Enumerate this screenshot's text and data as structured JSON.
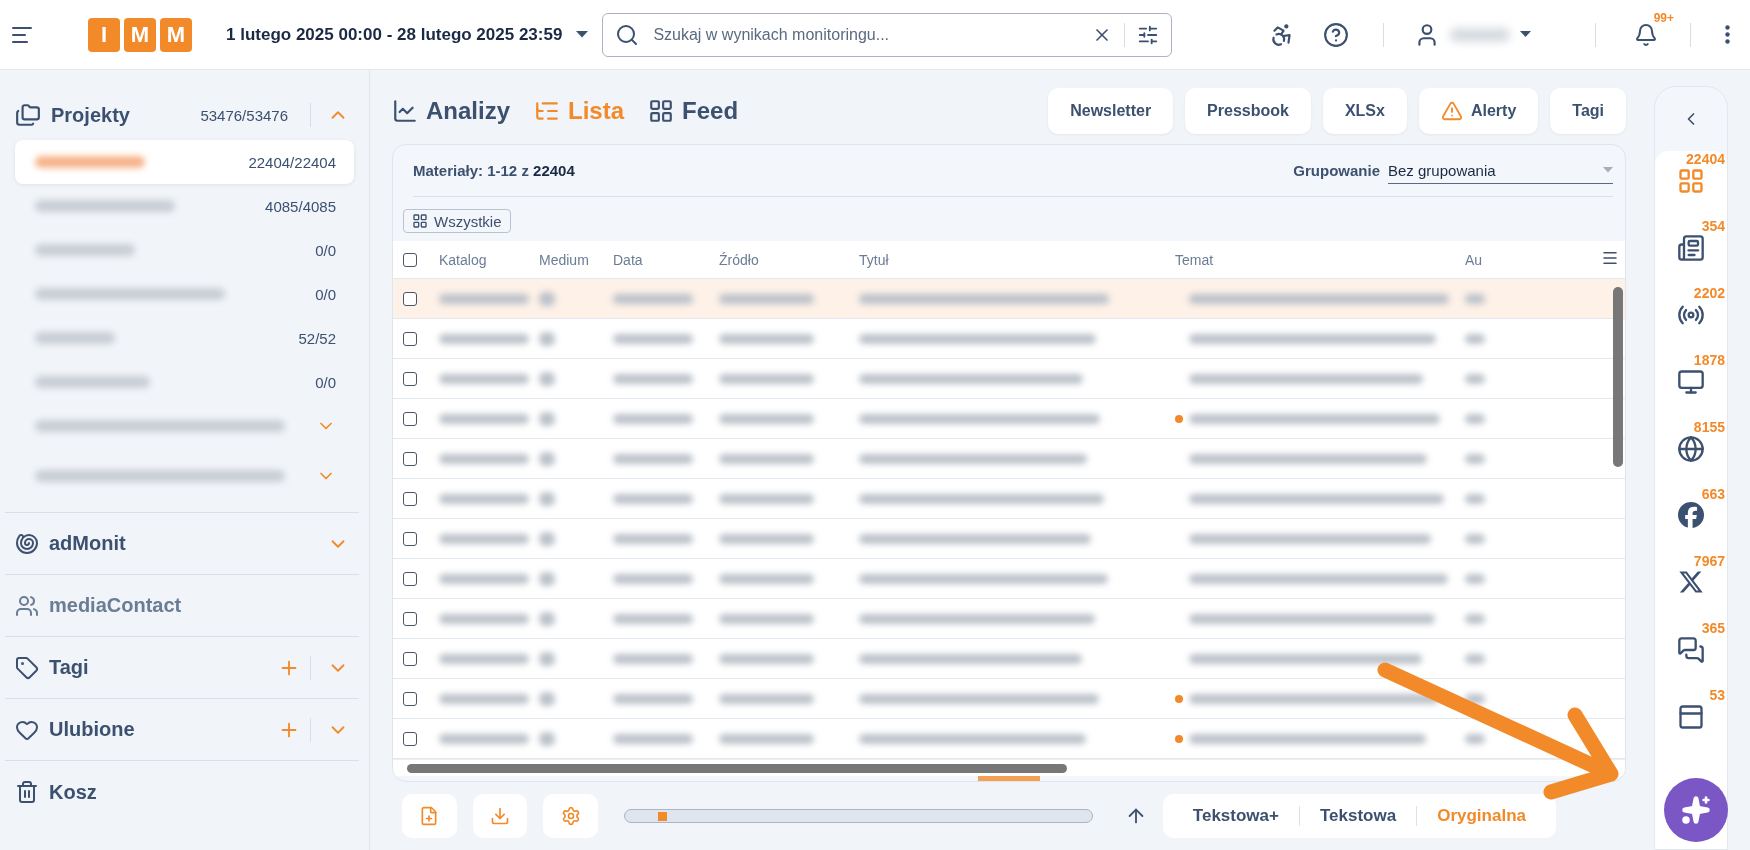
{
  "header": {
    "logo": [
      "I",
      "M",
      "M"
    ],
    "date_range": "1 lutego 2025 00:00 - 28 lutego 2025 23:59",
    "search": {
      "placeholder": "Szukaj w wynikach monitoringu..."
    },
    "notifications": "99+"
  },
  "sidebar": {
    "projects": {
      "label": "Projekty",
      "count": "53476/53476",
      "expanded": true,
      "items": [
        {
          "kind": "count",
          "count": "22404/22404",
          "selected": true
        },
        {
          "kind": "count",
          "count": "4085/4085",
          "selected": false
        },
        {
          "kind": "count",
          "count": "0/0",
          "selected": false
        },
        {
          "kind": "count",
          "count": "0/0",
          "selected": false
        },
        {
          "kind": "count",
          "count": "52/52",
          "selected": false
        },
        {
          "kind": "count",
          "count": "0/0",
          "selected": false
        },
        {
          "kind": "group",
          "selected": false,
          "expanded": false
        },
        {
          "kind": "group",
          "selected": false,
          "expanded": false
        }
      ]
    },
    "sections": [
      {
        "label": "adMonit",
        "kind": "expandable",
        "expanded": false
      },
      {
        "label": "mediaContact",
        "kind": "plain"
      },
      {
        "label": "Tagi",
        "kind": "addable",
        "expanded": false
      },
      {
        "label": "Ulubione",
        "kind": "addable",
        "expanded": false
      },
      {
        "label": "Kosz",
        "kind": "plain"
      }
    ]
  },
  "views": [
    {
      "label": "Analizy",
      "selected": false
    },
    {
      "label": "Lista",
      "selected": true
    },
    {
      "label": "Feed",
      "selected": false
    }
  ],
  "actions": [
    {
      "label": "Newsletter",
      "kind": "plain"
    },
    {
      "label": "Pressbook",
      "kind": "plain"
    },
    {
      "label": "XLSx",
      "kind": "plain"
    },
    {
      "label": "Alerty",
      "kind": "alert"
    },
    {
      "label": "Tagi",
      "kind": "plain"
    }
  ],
  "materials": {
    "label": "Materiały:",
    "range": "1-12 z **22404**"
  },
  "grouping": {
    "label": "Grupowanie",
    "value": "Bez grupowania"
  },
  "filter_chip": "Wszystkie",
  "table": {
    "all_checked": false,
    "columns": [
      "Katalog",
      "Medium",
      "Data",
      "Źródło",
      "Tytuł",
      "Temat",
      "Au"
    ],
    "rows": [
      {
        "selected": true,
        "checked": false,
        "flagged": false
      },
      {
        "selected": false,
        "checked": false,
        "flagged": false
      },
      {
        "selected": false,
        "checked": false,
        "flagged": false
      },
      {
        "selected": false,
        "checked": false,
        "flagged": true
      },
      {
        "selected": false,
        "checked": false,
        "flagged": false
      },
      {
        "selected": false,
        "checked": false,
        "flagged": false
      },
      {
        "selected": false,
        "checked": false,
        "flagged": false
      },
      {
        "selected": false,
        "checked": false,
        "flagged": false
      },
      {
        "selected": false,
        "checked": false,
        "flagged": false
      },
      {
        "selected": false,
        "checked": false,
        "flagged": false
      },
      {
        "selected": false,
        "checked": false,
        "flagged": true
      },
      {
        "selected": false,
        "checked": false,
        "flagged": true
      }
    ]
  },
  "bottom": {
    "zoom": {
      "level": 0.07
    },
    "modes": [
      {
        "label": "Tekstowa+",
        "selected": false
      },
      {
        "label": "Tekstowa",
        "selected": false
      },
      {
        "label": "Oryginalna",
        "selected": true
      }
    ]
  },
  "rail": [
    {
      "count": "22404",
      "selected": true
    },
    {
      "count": "354",
      "selected": false
    },
    {
      "count": "2202",
      "selected": false
    },
    {
      "count": "1878",
      "selected": false
    },
    {
      "count": "8155",
      "selected": false
    },
    {
      "count": "663",
      "selected": false
    },
    {
      "count": "7967",
      "selected": false
    },
    {
      "count": "365",
      "selected": false
    },
    {
      "count": "53",
      "selected": false
    }
  ]
}
